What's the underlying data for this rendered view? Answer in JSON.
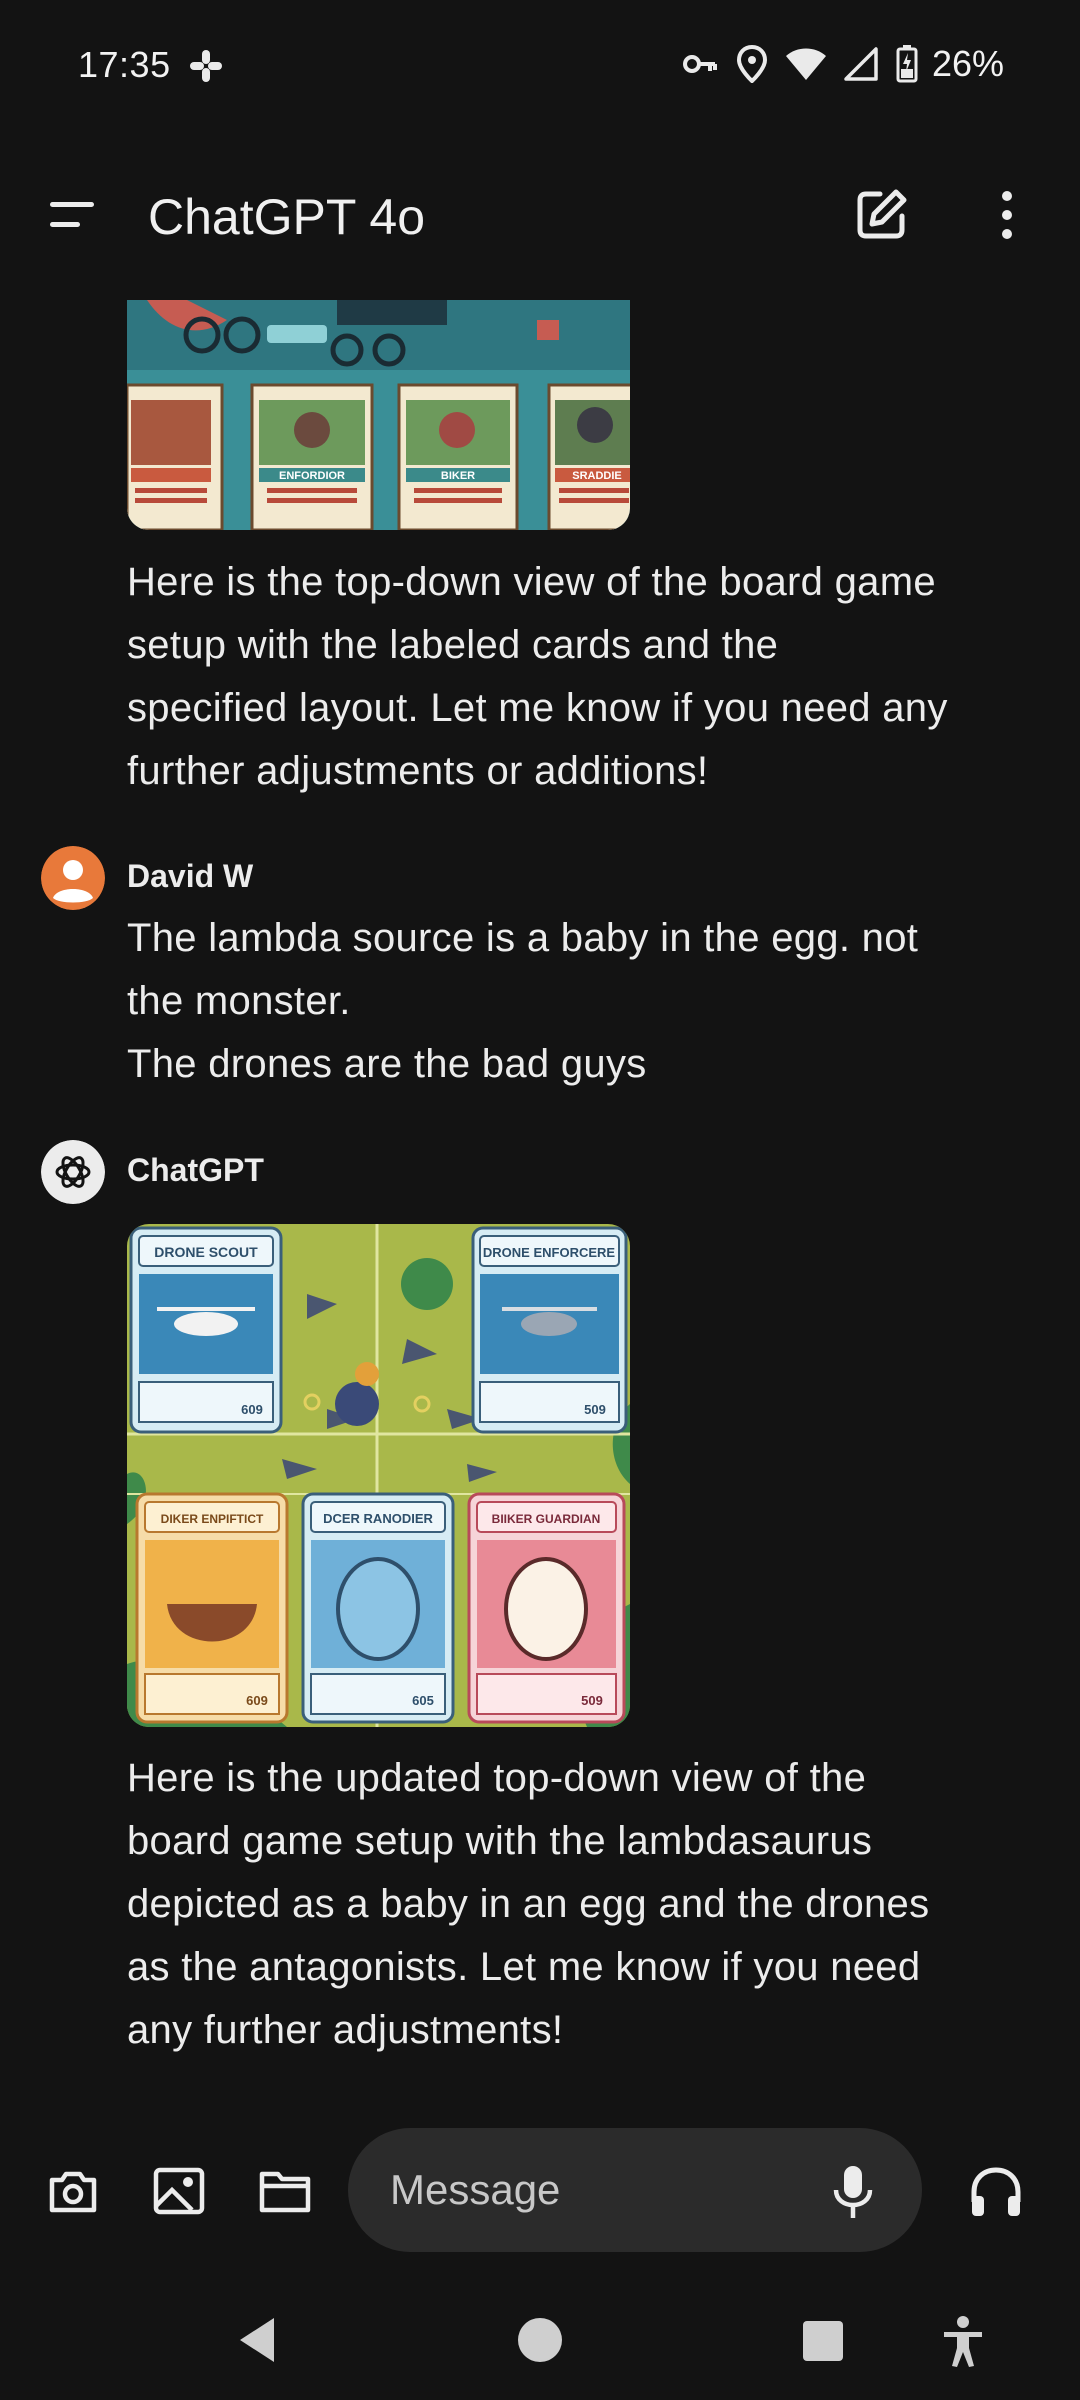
{
  "status_bar": {
    "time": "17:35",
    "battery": "26%",
    "icons": [
      "slack-icon",
      "vpn-key-icon",
      "location-icon",
      "wifi-icon",
      "cellular-signal-icon",
      "battery-icon"
    ]
  },
  "app_bar": {
    "title": "ChatGPT 4o",
    "icons": [
      "menu-icon",
      "new-chat-icon",
      "more-vert-icon"
    ]
  },
  "conversation": {
    "top_image_card_labels": [
      "ENFORDIOR",
      "BIKER",
      "SRADDIE"
    ],
    "assistant_reply_1": [
      "Here is the top-down view of the board game",
      "setup with the labeled cards and the",
      "specified layout. Let me know if you need any",
      "further adjustments or additions!"
    ],
    "user": {
      "name": "David W",
      "lines": [
        "The lambda source is a baby in the egg. not",
        "the monster.",
        "The drones are the bad guys"
      ]
    },
    "assistant": {
      "name": "ChatGPT",
      "image_card_labels": [
        "DRONE SCOUT",
        "DRONE ENFORCERE",
        "DIKER ENPIFTICT",
        "DCER RANODIER",
        "BIIKER GUARDIAN"
      ],
      "image_card_numbers": [
        "609",
        "509",
        "609",
        "605",
        "509"
      ],
      "reply_lines": [
        "Here is the updated top-down view of the",
        "board game setup with the lambdasaurus",
        "depicted as a baby in an egg and the drones",
        "as the antagonists. Let me know if you need",
        "any further adjustments!"
      ]
    }
  },
  "input_bar": {
    "placeholder": "Message",
    "icons": [
      "camera-icon",
      "image-icon",
      "folder-icon",
      "mic-icon",
      "headphones-icon"
    ]
  },
  "colors": {
    "background": "#131313",
    "input_pill": "#2b2b2b",
    "user_avatar": "#e8793a",
    "text": "#ececec"
  }
}
